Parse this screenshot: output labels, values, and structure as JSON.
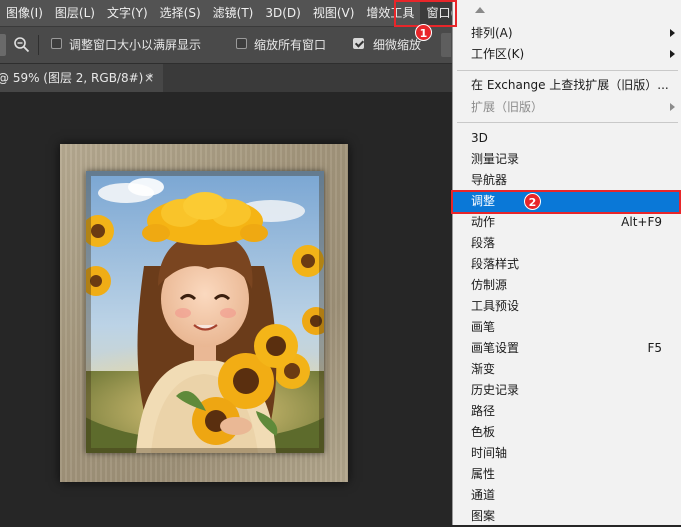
{
  "menubar": {
    "items": [
      "图像(I)",
      "图层(L)",
      "文字(Y)",
      "选择(S)",
      "滤镜(T)",
      "3D(D)",
      "视图(V)",
      "增效工具",
      "窗口(W)"
    ],
    "active_index": 8
  },
  "options_bar": {
    "resize_windows_label": "调整窗口大小以满屏显示",
    "resize_windows_checked": false,
    "zoom_all_label": "缩放所有窗口",
    "zoom_all_checked": false,
    "scrubby_zoom_label": "细微缩放",
    "scrubby_zoom_checked": true
  },
  "document_tab": {
    "title": "@ 59% (图层 2, RGB/8#) *",
    "close_glyph": "×"
  },
  "window_menu": {
    "arrange": "排列(A)",
    "workspace": "工作区(K)",
    "find_exchange": "在 Exchange 上查找扩展（旧版）...",
    "extensions": "扩展（旧版）",
    "items": [
      {
        "label": "3D",
        "shortcut": ""
      },
      {
        "label": "测量记录",
        "shortcut": ""
      },
      {
        "label": "导航器",
        "shortcut": ""
      },
      {
        "label": "调整",
        "shortcut": ""
      },
      {
        "label": "动作",
        "shortcut": "Alt+F9"
      },
      {
        "label": "段落",
        "shortcut": ""
      },
      {
        "label": "段落样式",
        "shortcut": ""
      },
      {
        "label": "仿制源",
        "shortcut": ""
      },
      {
        "label": "工具预设",
        "shortcut": ""
      },
      {
        "label": "画笔",
        "shortcut": ""
      },
      {
        "label": "画笔设置",
        "shortcut": "F5"
      },
      {
        "label": "渐变",
        "shortcut": ""
      },
      {
        "label": "历史记录",
        "shortcut": ""
      },
      {
        "label": "路径",
        "shortcut": ""
      },
      {
        "label": "色板",
        "shortcut": ""
      },
      {
        "label": "时间轴",
        "shortcut": ""
      },
      {
        "label": "属性",
        "shortcut": ""
      },
      {
        "label": "通道",
        "shortcut": ""
      },
      {
        "label": "图案",
        "shortcut": ""
      }
    ],
    "highlighted_index": 3
  },
  "annotations": {
    "badge_1": "1",
    "badge_2": "2",
    "color": "#e8262a"
  },
  "colors": {
    "menubar": "#535353",
    "canvas": "#262626",
    "menu_bg": "#f2f2f2",
    "highlight": "#0a78d7"
  }
}
